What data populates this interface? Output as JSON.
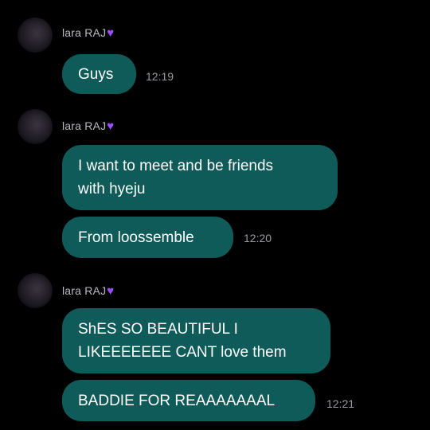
{
  "colors": {
    "background": "#000000",
    "bubble": "#0e5b59",
    "bubble_text": "#ffffff",
    "sender_name": "#b9b9bf",
    "timestamp": "#9a9aa0",
    "heart": "#9b4dff"
  },
  "messages": [
    {
      "sender": "lara RAJ",
      "heart_icon": "purple-heart-icon",
      "bubbles": [
        {
          "text": "Guys",
          "time": "12:19"
        }
      ]
    },
    {
      "sender": "lara RAJ",
      "heart_icon": "purple-heart-icon",
      "bubbles": [
        {
          "text": "I want to meet and be friends\nwith hyeju",
          "time": ""
        },
        {
          "text": "From loossemble",
          "time": "12:20"
        }
      ]
    },
    {
      "sender": "lara RAJ",
      "heart_icon": "purple-heart-icon",
      "bubbles": [
        {
          "text": "ShES SO BEAUTIFUL I\nLIKEEEEEEE CANT love them",
          "time": ""
        },
        {
          "text": "BADDIE FOR REAAAAAAAL",
          "time": "12:21"
        }
      ]
    }
  ]
}
